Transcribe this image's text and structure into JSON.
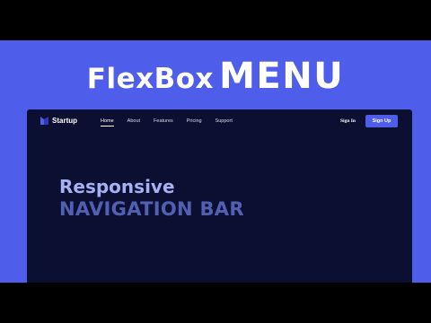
{
  "banner": {
    "title_part1": "FlexBox",
    "title_part2": "MENU"
  },
  "navbar": {
    "brand": "Startup",
    "links": [
      {
        "label": "Home",
        "active": true
      },
      {
        "label": "About",
        "active": false
      },
      {
        "label": "Features",
        "active": false
      },
      {
        "label": "Pricing",
        "active": false
      },
      {
        "label": "Support",
        "active": false
      }
    ],
    "signin_label": "Sign In",
    "signup_label": "Sign Up"
  },
  "hero": {
    "line1": "Responsive",
    "line2": "NAVIGATION BAR"
  },
  "colors": {
    "banner_background": "#4f5deb",
    "screen_background": "#0b1033",
    "accent": "#4f5deb",
    "hero_line1": "#a6b0f2",
    "hero_line2": "#5360b2"
  },
  "icons": {
    "logo": "logo-icon"
  }
}
